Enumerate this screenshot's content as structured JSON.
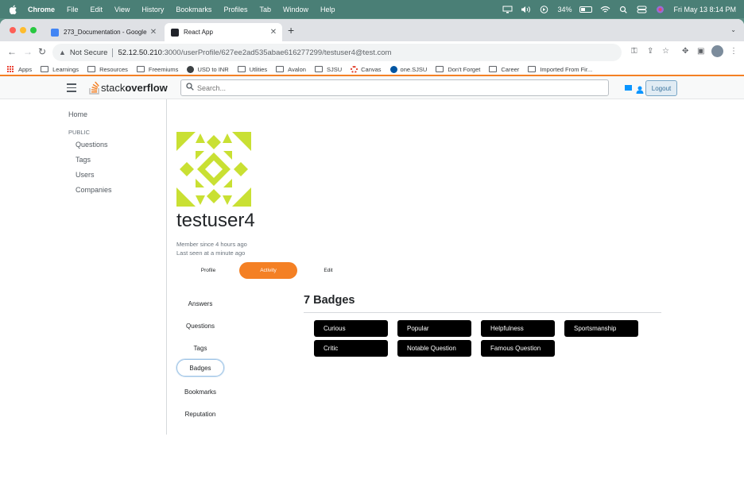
{
  "menubar": {
    "items": [
      "Chrome",
      "File",
      "Edit",
      "View",
      "History",
      "Bookmarks",
      "Profiles",
      "Tab",
      "Window",
      "Help"
    ],
    "battery": "34%",
    "datetime": "Fri May 13  8:14 PM"
  },
  "browser": {
    "tabs": [
      {
        "title": "273_Documentation - Google D",
        "active": false
      },
      {
        "title": "React App",
        "active": true
      }
    ],
    "address": {
      "security": "Not Secure",
      "host": "52.12.50.210",
      "path": ":3000/userProfile/627ee2ad535abae616277299/testuser4@test.com"
    },
    "bookmarks": [
      "Apps",
      "Learnings",
      "Resources",
      "Freemiums",
      "USD to INR",
      "Utlities",
      "Avalon",
      "SJSU",
      "Canvas",
      "one.SJSU",
      "Don't Forget",
      "Career",
      "Imported From Fir..."
    ]
  },
  "header": {
    "logo_light": "stack",
    "logo_bold": "overflow",
    "search_placeholder": "Search...",
    "logout_label": "Logout"
  },
  "leftnav": {
    "home": "Home",
    "section": "PUBLIC",
    "items": [
      "Questions",
      "Tags",
      "Users",
      "Companies"
    ]
  },
  "profile": {
    "username": "testuser4",
    "member_since": "Member since 4 hours ago",
    "last_seen": "Last seen at a minute ago",
    "tabs": [
      "Profile",
      "Activity",
      "Edit"
    ],
    "active_tab": "Activity",
    "identicon_color": "#c9e033"
  },
  "activity": {
    "items": [
      "Answers",
      "Questions",
      "Tags",
      "Badges",
      "Bookmarks",
      "Reputation"
    ],
    "selected": "Badges",
    "badges_title": "7 Badges",
    "badges": [
      "Curious",
      "Popular",
      "Helpfulness",
      "Sportsmanship",
      "Critic",
      "Notable Question",
      "Famous Question"
    ]
  },
  "colors": {
    "accent": "#f48024",
    "badge_bg": "#000000",
    "desktop": "#5a8f84"
  }
}
